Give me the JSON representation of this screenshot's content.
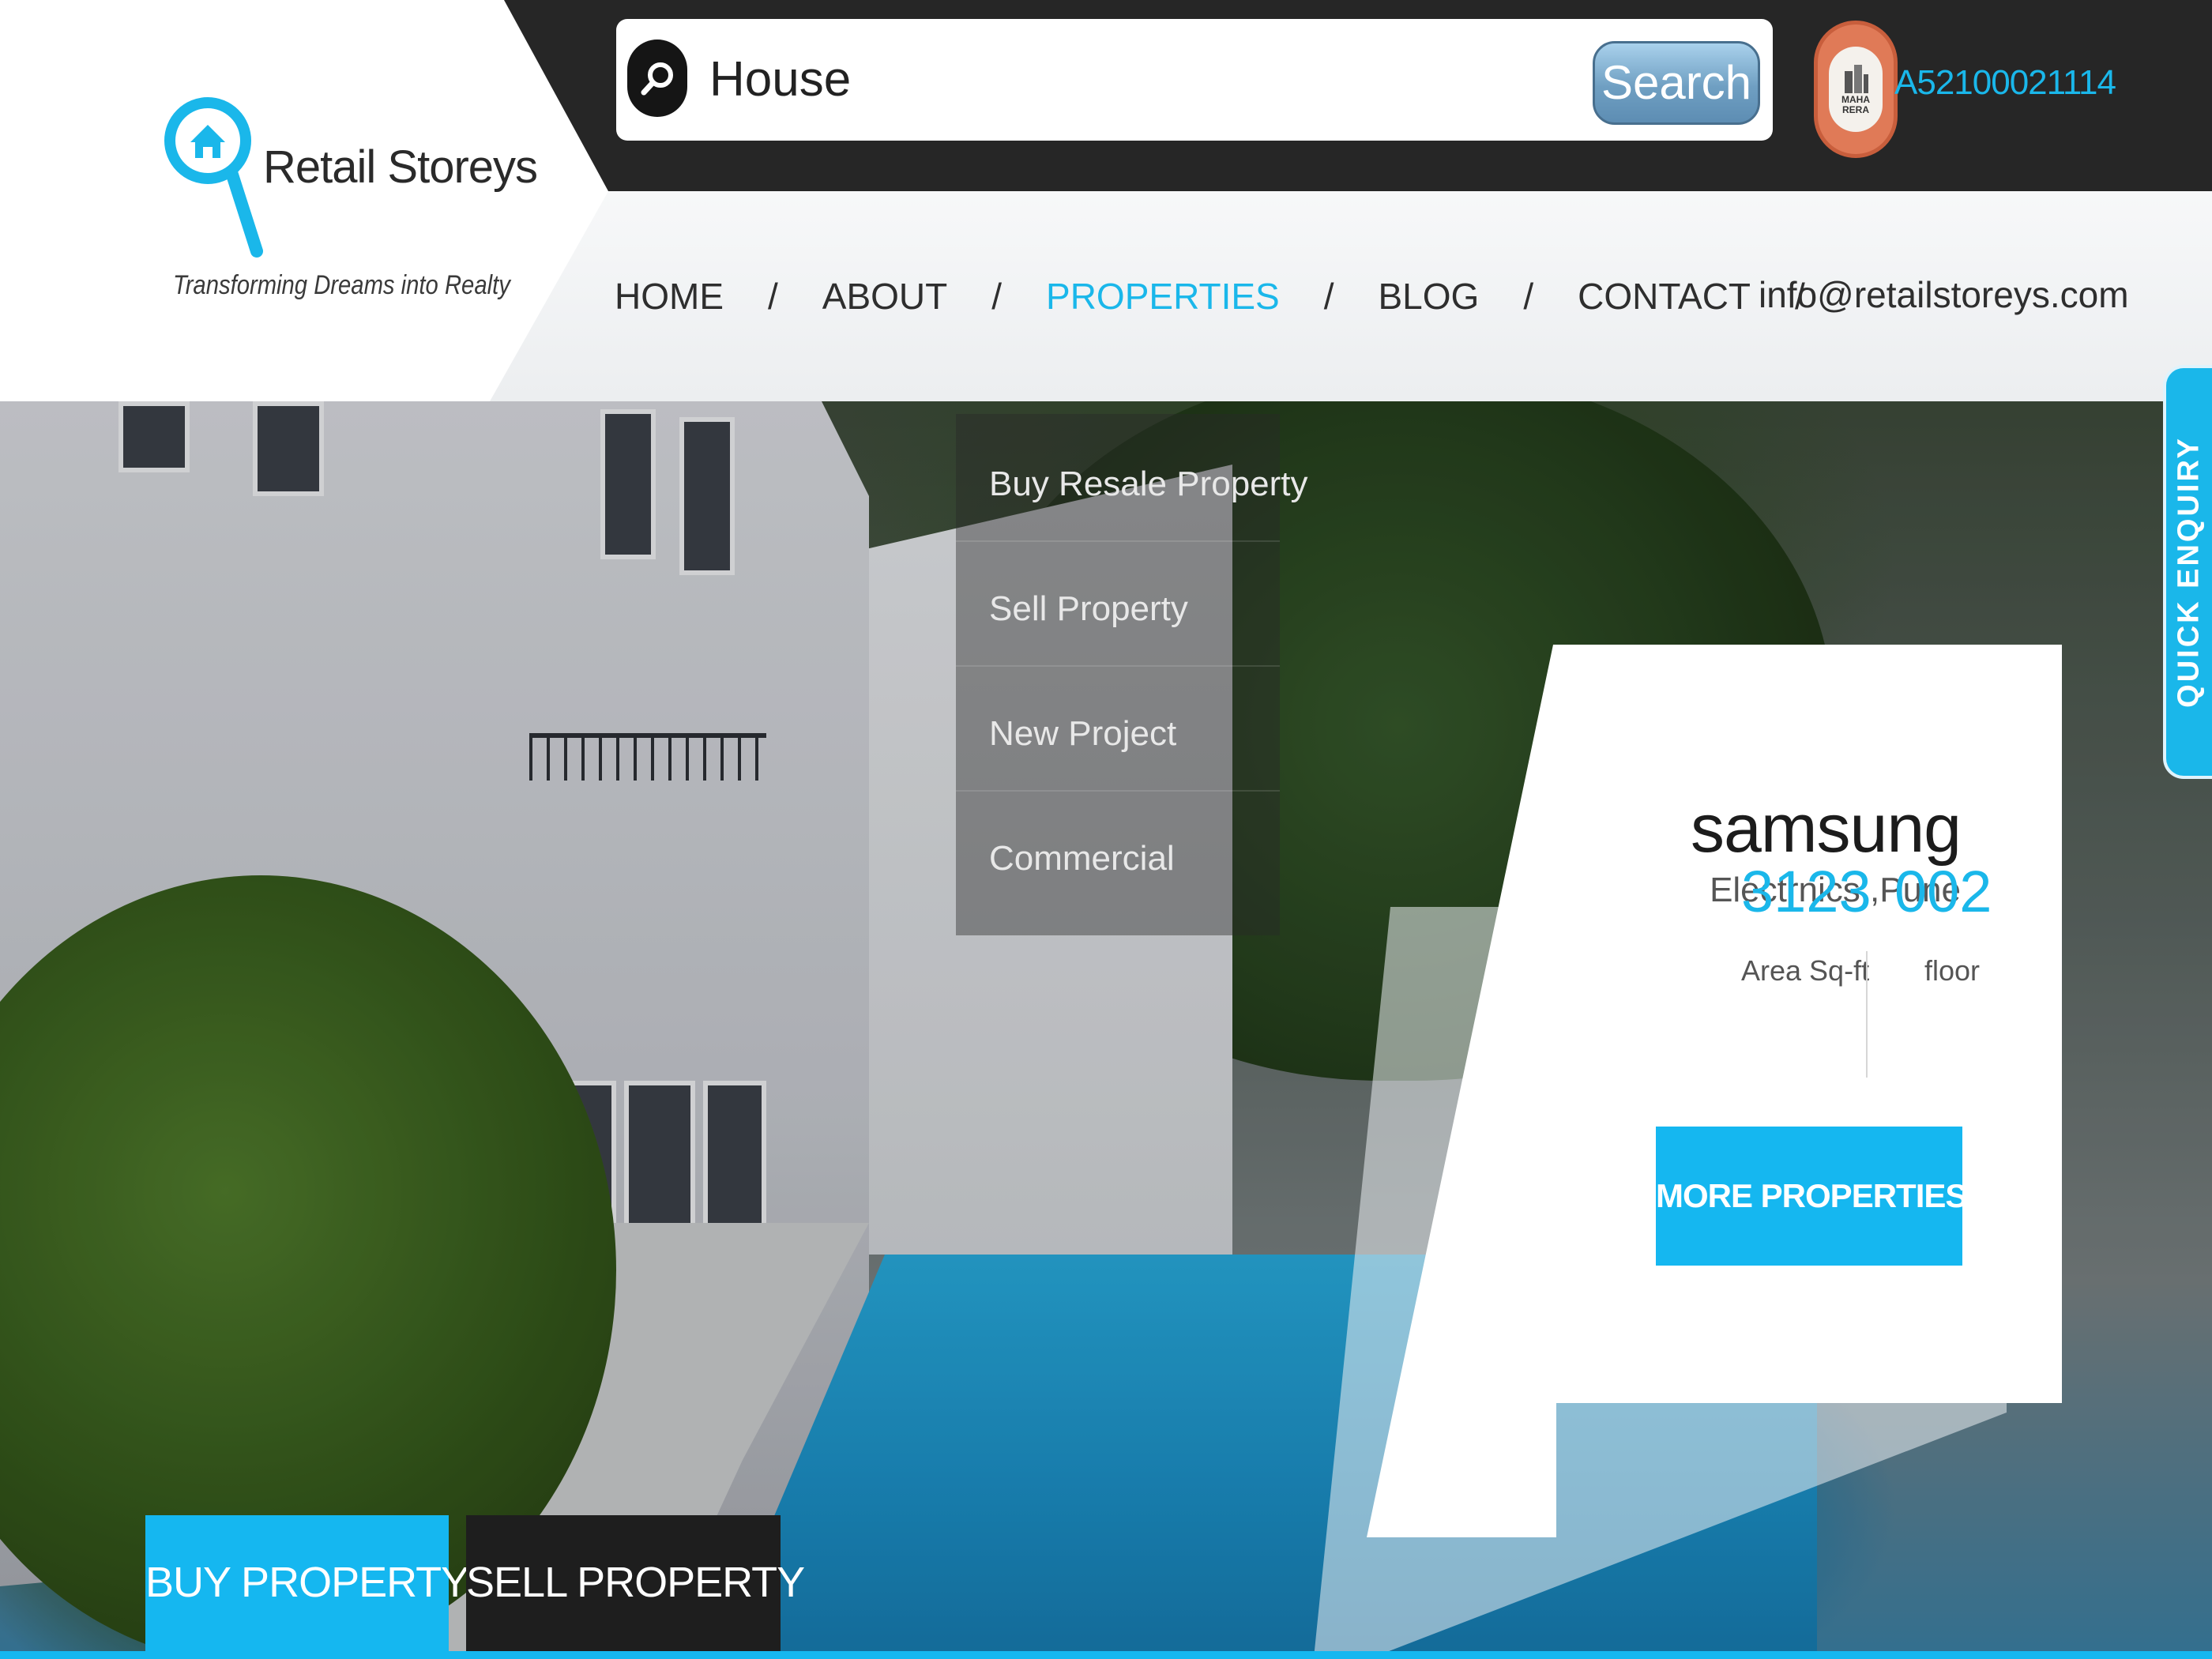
{
  "brand": {
    "name": "Retail Storeys",
    "tagline": "Transforming Dreams into Realty"
  },
  "search": {
    "value": "House",
    "button_label": "Search"
  },
  "rera": {
    "badge_text": "MAHA RERA",
    "number": "A52100021114"
  },
  "nav": {
    "items": [
      {
        "label": "HOME"
      },
      {
        "label": "ABOUT"
      },
      {
        "label": "PROPERTIES",
        "active": true
      },
      {
        "label": "BLOG"
      },
      {
        "label": "CONTACT"
      }
    ],
    "separator": "/",
    "email": "info@retailstoreys.com"
  },
  "properties_menu": {
    "items": [
      "Buy Resale Property",
      "Sell Property",
      "New Project",
      "Commercial"
    ]
  },
  "featured": {
    "title": "samsung",
    "subtitle": "Electrnics ,Pune",
    "area_value": "3123",
    "area_label": "Area Sq-ft",
    "floor_value": "002",
    "floor_label": "floor",
    "button_label": "MORE PROPERTIES"
  },
  "quick_enquiry": "QUICK ENQUIRY",
  "tabs": {
    "buy_label": "BUY PROPERTY",
    "sell_label": "SELL PROPERTY"
  },
  "colors": {
    "accent": "#1ab7ea",
    "dark": "#262626",
    "rera_badge": "#e07a57"
  }
}
